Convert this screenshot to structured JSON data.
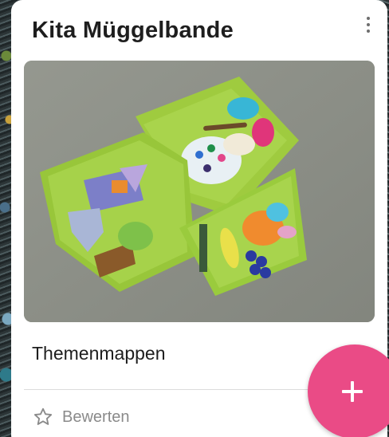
{
  "card": {
    "title": "Kita Müggelbande",
    "image_alt": "Themenmappen",
    "caption": "Themenmappen",
    "rate_label": "Bewerten"
  },
  "icons": {
    "menu": "more-vertical-icon",
    "star": "star-outline-icon",
    "add": "plus-icon"
  },
  "colors": {
    "fab": "#ea4b86",
    "card_background": "#ffffff",
    "title_text": "#1e1e1e",
    "rate_text": "#8a8a8a"
  }
}
